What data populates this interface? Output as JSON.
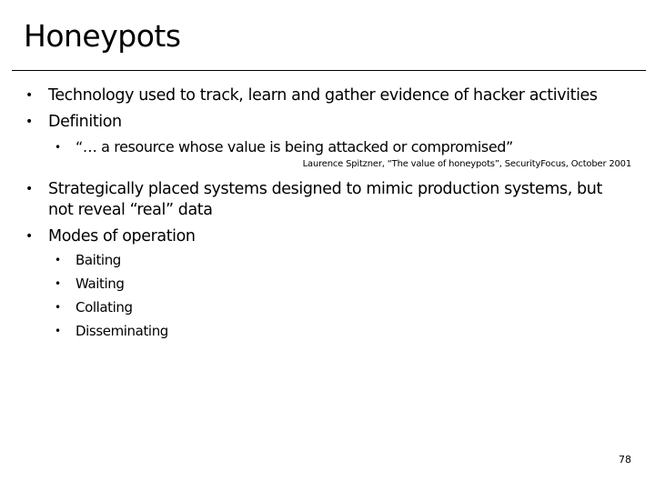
{
  "slide": {
    "title": "Honeypots",
    "bullet_char": "•",
    "items": [
      {
        "text": "Technology used to track, learn and gather evidence of hacker activities"
      },
      {
        "text": "Definition",
        "sub": [
          {
            "text": "“… a resource whose value is being attacked or compromised”"
          }
        ],
        "citation": "Laurence Spitzner, “The value of honeypots”, SecurityFocus, October 2001"
      },
      {
        "text_line1": "Strategically placed systems designed to mimic production systems, but",
        "text_line2": "not reveal “real” data"
      },
      {
        "text": "Modes of operation",
        "sub": [
          {
            "text": "Baiting"
          },
          {
            "text": "Waiting"
          },
          {
            "text": "Collating"
          },
          {
            "text": "Disseminating"
          }
        ]
      }
    ],
    "page_number": "78"
  }
}
